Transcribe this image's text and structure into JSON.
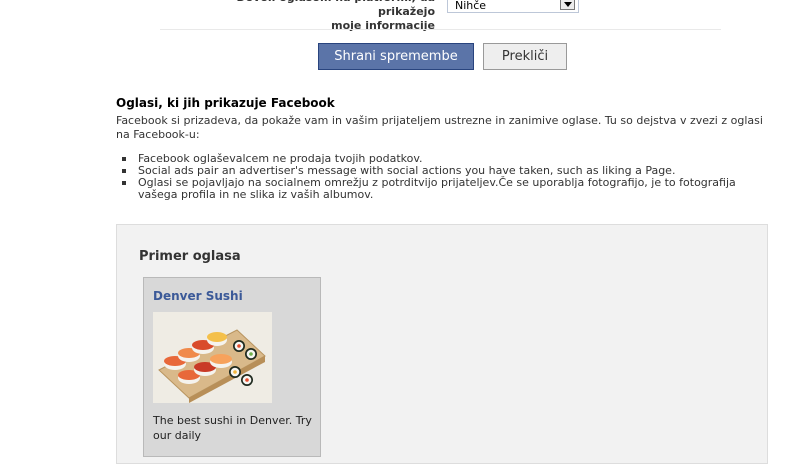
{
  "settings": {
    "row_label_line1": "Dovoli oglasom na platformi, da prikažejo",
    "row_label_line2": "moje informacije",
    "select_value": "Nihče"
  },
  "actions": {
    "save_label": "Shrani spremembe",
    "cancel_label": "Prekliči"
  },
  "ads_section": {
    "title": "Oglasi, ki jih prikazuje Facebook",
    "description": "Facebook si prizadeva, da pokaže vam in vašim prijateljem ustrezne in zanimive oglase. Tu so dejstva v zvezi z oglasi na Facebook-u:",
    "bullets": [
      "Facebook oglaševalcem ne prodaja tvojih podatkov.",
      "Social ads pair an advertiser's message with social actions you have taken, such as liking a Page.",
      "Oglasi se pojavljajo na socialnem omrežju z potrditvijo prijateljev.Če se uporablja fotografijo, je to fotografija vašega profila in ne slika iz vaših albumov."
    ]
  },
  "example_ad": {
    "panel_title": "Primer oglasa",
    "name": "Denver Sushi",
    "image_icon": "sushi-photo",
    "body": "The best sushi in Denver. Try our daily"
  },
  "colors": {
    "fb_blue": "#3b5998",
    "save_button": "#5b74a8",
    "panel_bg": "#f2f2f2"
  }
}
